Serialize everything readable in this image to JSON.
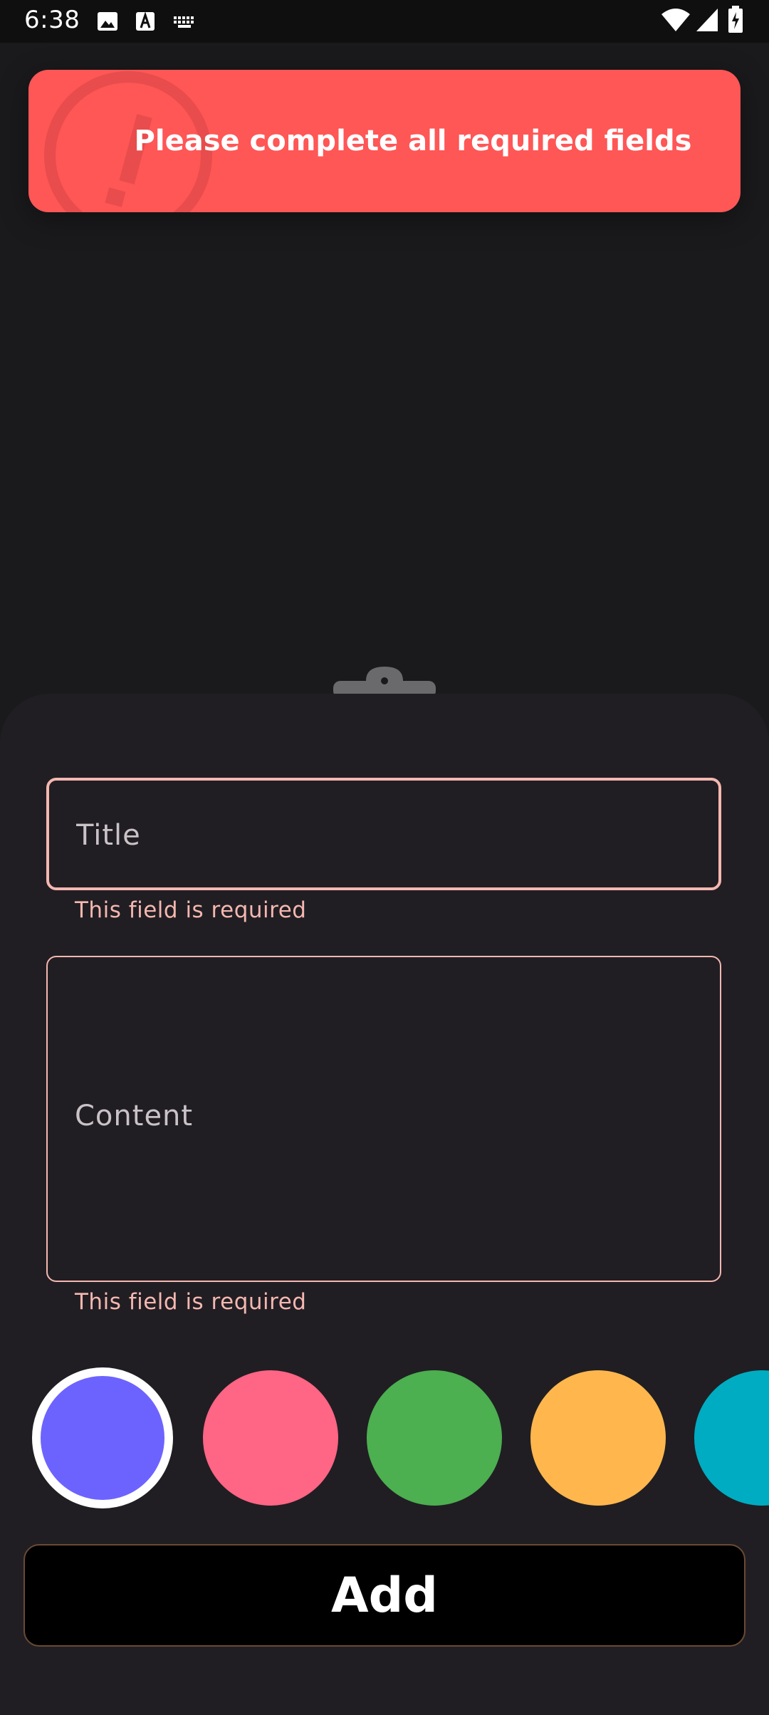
{
  "status_bar": {
    "time": "6:38",
    "left_icons": [
      "image-icon",
      "font-a-icon",
      "keyboard-icon"
    ],
    "right_icons": [
      "wifi-icon",
      "signal-icon",
      "battery-charging-icon"
    ]
  },
  "banner": {
    "message": "Please complete all required fields",
    "icon": "warning-icon",
    "color": "#ff5656"
  },
  "form": {
    "title": {
      "placeholder": "Title",
      "value": "",
      "error": "This field is required"
    },
    "content": {
      "placeholder": "Content",
      "value": "",
      "error": "This field is required"
    },
    "error_color": "#f5b7b0"
  },
  "colors": [
    {
      "name": "purple",
      "hex": "#6c63ff",
      "selected": true
    },
    {
      "name": "pink",
      "hex": "#ff6584",
      "selected": false
    },
    {
      "name": "green",
      "hex": "#4caf50",
      "selected": false
    },
    {
      "name": "orange",
      "hex": "#ffb74d",
      "selected": false
    },
    {
      "name": "cyan",
      "hex": "#00acc1",
      "selected": false
    }
  ],
  "actions": {
    "add_label": "Add"
  }
}
